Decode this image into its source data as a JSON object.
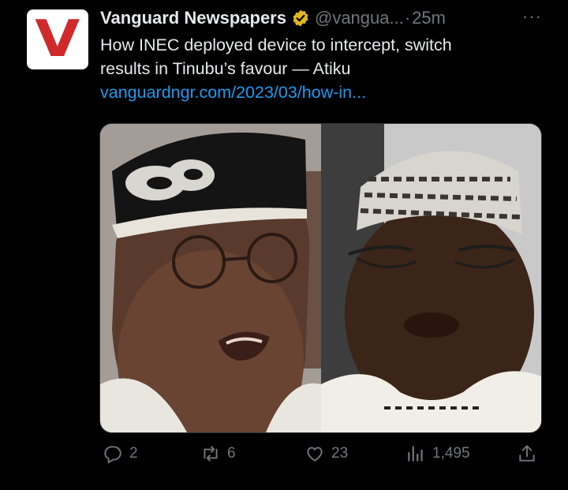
{
  "tweet": {
    "avatar_letter": "V",
    "author_name": "Vanguard Newspapers",
    "handle": "@vangua...",
    "separator": "·",
    "time": "25m",
    "more": "···",
    "text_line1": "How INEC deployed device to intercept, switch",
    "text_line2": "results in Tinubu’s favour — Atiku",
    "link": "vanguardngr.com/2023/03/how-in..."
  },
  "actions": {
    "replies": "2",
    "retweets": "6",
    "likes": "23",
    "views": "1,495"
  },
  "colors": {
    "background": "#000000",
    "text": "#e7e9ea",
    "muted": "#71767b",
    "link": "#1d9bf0",
    "verified": "#e2b719",
    "brand_red": "#d0292b"
  },
  "icons": [
    "verified-badge-icon",
    "reply-icon",
    "retweet-icon",
    "like-icon",
    "views-icon",
    "share-icon"
  ]
}
